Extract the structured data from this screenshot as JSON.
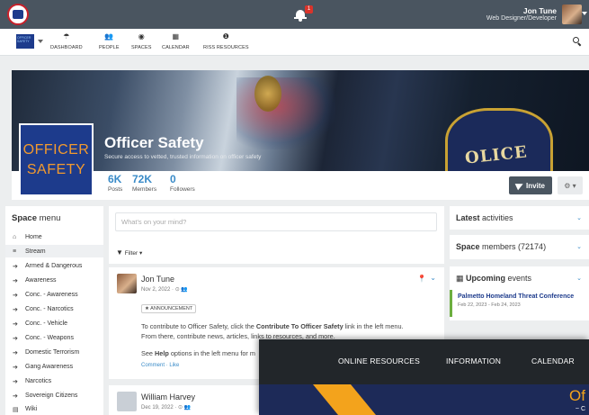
{
  "topbar": {
    "notification_count": "1",
    "user_name": "Jon Tune",
    "user_role": "Web Designer/Developer"
  },
  "navbar": {
    "logo_text": "OFFICER SAFETY",
    "items": [
      {
        "label": "DASHBOARD",
        "icon": "dashboard-icon",
        "glyph": "☂"
      },
      {
        "label": "PEOPLE",
        "icon": "people-icon",
        "glyph": "👥"
      },
      {
        "label": "SPACES",
        "icon": "spaces-icon",
        "glyph": "◉"
      },
      {
        "label": "CALENDAR",
        "icon": "calendar-icon",
        "glyph": "▦"
      },
      {
        "label": "RISS RESOURCES",
        "icon": "info-icon",
        "glyph": "❶"
      }
    ]
  },
  "space": {
    "logo_line1": "OFFICER",
    "logo_line2": "SAFETY",
    "title": "Officer Safety",
    "subtitle": "Secure access to vetted, trusted information on officer safety",
    "hero_police_text": "OLICE",
    "stats": [
      {
        "value": "6K",
        "label": "Posts"
      },
      {
        "value": "72K",
        "label": "Members"
      },
      {
        "value": "0",
        "label": "Followers"
      }
    ],
    "invite_label": "Invite",
    "settings_glyph": "⚙ ▾"
  },
  "sidebar": {
    "title_bold": "Space",
    "title_rest": " menu",
    "items": [
      {
        "label": "Home",
        "icon": "home-icon",
        "glyph": "⌂"
      },
      {
        "label": "Stream",
        "icon": "stream-icon",
        "glyph": "≡"
      },
      {
        "label": "Armed & Dangerous",
        "icon": "circle-arrow-icon",
        "glyph": "➔"
      },
      {
        "label": "Awareness",
        "icon": "circle-arrow-icon",
        "glyph": "➔"
      },
      {
        "label": "Conc. - Awareness",
        "icon": "circle-arrow-icon",
        "glyph": "➔"
      },
      {
        "label": "Conc. - Narcotics",
        "icon": "circle-arrow-icon",
        "glyph": "➔"
      },
      {
        "label": "Conc. - Vehicle",
        "icon": "circle-arrow-icon",
        "glyph": "➔"
      },
      {
        "label": "Conc. - Weapons",
        "icon": "circle-arrow-icon",
        "glyph": "➔"
      },
      {
        "label": "Domestic Terrorism",
        "icon": "circle-arrow-icon",
        "glyph": "➔"
      },
      {
        "label": "Gang Awareness",
        "icon": "circle-arrow-icon",
        "glyph": "➔"
      },
      {
        "label": "Narcotics",
        "icon": "circle-arrow-icon",
        "glyph": "➔"
      },
      {
        "label": "Sovereign Citizens",
        "icon": "circle-arrow-icon",
        "glyph": "➔"
      },
      {
        "label": "Wiki",
        "icon": "wiki-icon",
        "glyph": "▤"
      }
    ]
  },
  "feed": {
    "composer_placeholder": "What's on your mind?",
    "filter_label": "Filter",
    "posts": [
      {
        "author": "Jon Tune",
        "meta": "Nov 2, 2022 · ⊙ 👥",
        "tag": "★ ANNOUNCEMENT",
        "text_1": "To contribute to Officer Safety, click the ",
        "text_1_bold": "Contribute To Officer Safety",
        "text_1_end": " link in the left menu.",
        "text_2": "From there, contribute news, articles, links to resources, and more.",
        "text_3_start": "See ",
        "text_3_bold": "Help",
        "text_3_end": " options in the left menu for m",
        "links": "Comment · Like"
      },
      {
        "author": "William Harvey",
        "meta": "Dec 19, 2022 · ⊙ 👥"
      }
    ]
  },
  "right": {
    "activities_bold": "Latest",
    "activities_rest": " activities",
    "members_bold": "Space",
    "members_rest": " members (72174)",
    "events_bold": "Upcoming",
    "events_rest": " events",
    "event_title": "Palmetto Homeland Threat Conference",
    "event_dates": "Feb 22, 2023 - Feb 24, 2023"
  },
  "overlay": {
    "nav": [
      "ONLINE RESOURCES",
      "INFORMATION",
      "CALENDAR"
    ],
    "hero_text": "Of",
    "hero_small": "~ C"
  },
  "colors": {
    "accent_blue": "#3a8bc8",
    "topbar": "#4a5560",
    "brand_navy": "#1d3b8c",
    "brand_orange": "#f29a2e",
    "event_green": "#6cae3f"
  }
}
